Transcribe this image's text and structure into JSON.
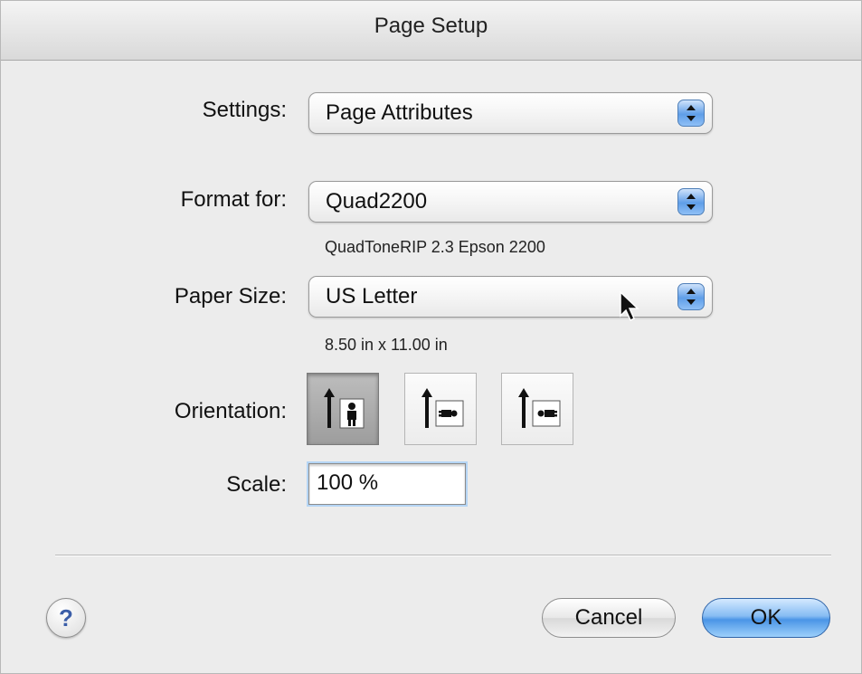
{
  "window": {
    "title": "Page Setup"
  },
  "settings": {
    "label": "Settings:",
    "value": "Page Attributes"
  },
  "format_for": {
    "label": "Format for:",
    "value": "Quad2200",
    "description": "QuadToneRIP 2.3 Epson 2200"
  },
  "paper_size": {
    "label": "Paper Size:",
    "value": "US Letter",
    "dimensions": "8.50 in x 11.00 in"
  },
  "orientation": {
    "label": "Orientation:",
    "options": [
      {
        "name": "portrait",
        "selected": true
      },
      {
        "name": "landscape-left",
        "selected": false
      },
      {
        "name": "landscape-right",
        "selected": false
      }
    ]
  },
  "scale": {
    "label": "Scale:",
    "value": "100 %"
  },
  "buttons": {
    "help": "?",
    "cancel": "Cancel",
    "ok": "OK"
  },
  "colors": {
    "accent": "#5f9ee8",
    "window_bg": "#ececec"
  }
}
